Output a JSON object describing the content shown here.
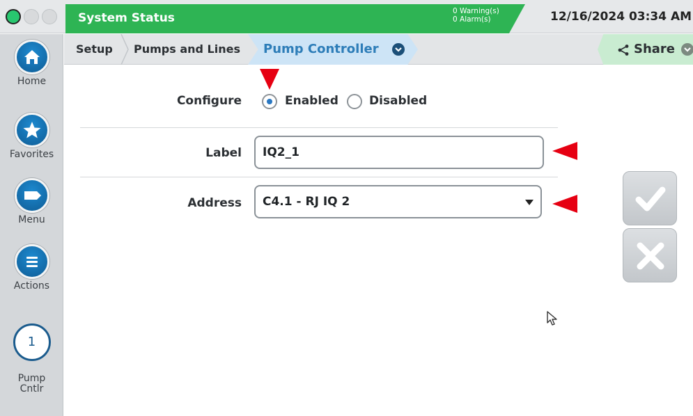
{
  "header": {
    "title": "System Status",
    "warnings": "0 Warning(s)",
    "alarms": "0 Alarm(s)",
    "datetime": "12/16/2024 03:34 AM"
  },
  "sidebar": {
    "items": [
      {
        "label": "Home",
        "icon": "home-icon"
      },
      {
        "label": "Favorites",
        "icon": "star-icon"
      },
      {
        "label": "Menu",
        "icon": "menu-icon"
      },
      {
        "label": "Actions",
        "icon": "list-icon"
      }
    ],
    "pump": {
      "number": "1",
      "label_line1": "Pump",
      "label_line2": "Cntlr"
    }
  },
  "breadcrumb": {
    "items": [
      "Setup",
      "Pumps and Lines"
    ],
    "active": "Pump Controller",
    "share": "Share"
  },
  "form": {
    "configure": {
      "label": "Configure",
      "options": [
        "Enabled",
        "Disabled"
      ],
      "selected": "Enabled"
    },
    "label_field": {
      "label": "Label",
      "value": "IQ2_1"
    },
    "address_field": {
      "label": "Address",
      "value": "C4.1 - RJ IQ 2"
    }
  },
  "colors": {
    "status_green": "#2eb454",
    "nav_blue": "#1577bd",
    "annotation_red": "#e60012"
  }
}
